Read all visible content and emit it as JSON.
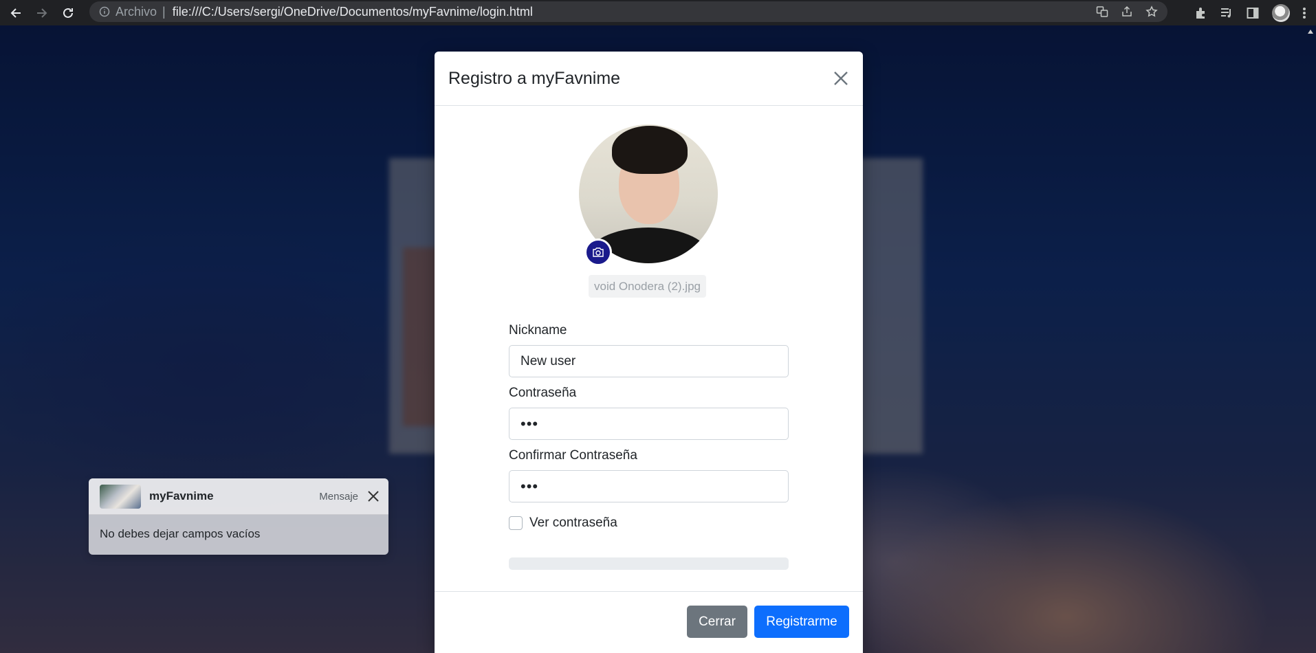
{
  "browser": {
    "scheme_label": "Archivo",
    "url": "file:///C:/Users/sergi/OneDrive/Documentos/myFavnime/login.html",
    "icons": [
      "back-arrow-icon",
      "forward-arrow-icon",
      "reload-icon",
      "info-icon",
      "translate-icon",
      "share-icon",
      "star-icon",
      "extensions-icon",
      "media-icon",
      "side-panel-icon",
      "profile-avatar",
      "kebab-menu-icon"
    ]
  },
  "toast": {
    "title": "myFavnime",
    "meta": "Mensaje",
    "body": "No debes dejar campos vacíos"
  },
  "modal": {
    "title": "Registro a myFavnime",
    "filename": "void Onodera (2).jpg",
    "fields": {
      "nickname_label": "Nickname",
      "nickname_value": "New user",
      "password_label": "Contraseña",
      "password_value": "•••",
      "confirm_label": "Confirmar Contraseña",
      "confirm_value": "•••"
    },
    "show_password_label": "Ver contraseña",
    "show_password_checked": false,
    "progress": 0,
    "buttons": {
      "close": "Cerrar",
      "register": "Registrarme"
    }
  },
  "colors": {
    "primary": "#0d6efd",
    "secondary": "#6c757d",
    "camera_button": "#1a1a8c"
  }
}
